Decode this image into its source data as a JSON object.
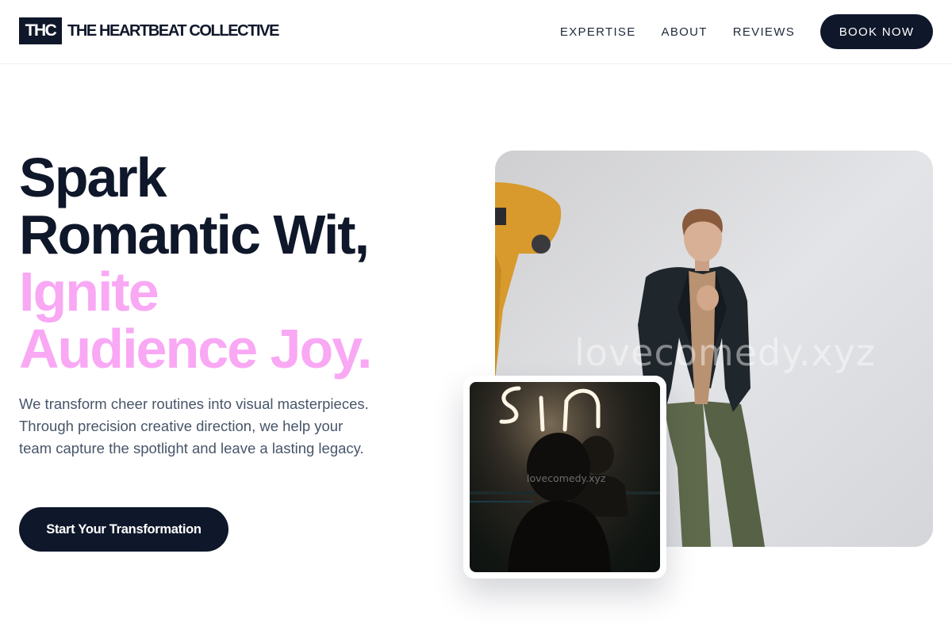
{
  "brand": {
    "mark": "THC",
    "name": "THE HEARTBEAT COLLECTIVE"
  },
  "nav": {
    "links": [
      "EXPERTISE",
      "ABOUT",
      "REVIEWS"
    ],
    "cta": "BOOK NOW"
  },
  "hero": {
    "headline_dark": [
      "Spark",
      "Romantic Wit,"
    ],
    "headline_accent": [
      "Ignite",
      "Audience Joy."
    ],
    "description": "We transform cheer routines into visual masterpieces. Through precision creative direction, we help your team capture the spotlight and leave a lasting legacy.",
    "cta_label": "Start Your Transformation",
    "main_image_watermark": "lovecomedy.xyz",
    "inset_image_watermark": "lovecomedy.xyz"
  },
  "colors": {
    "primary": "#0f172a",
    "accent": "#f9a8f4",
    "body_text": "#475569"
  },
  "icons": {
    "main_photo": "photo-man-in-blazer",
    "inset_photo": "photo-neon-sign-silhouette"
  }
}
